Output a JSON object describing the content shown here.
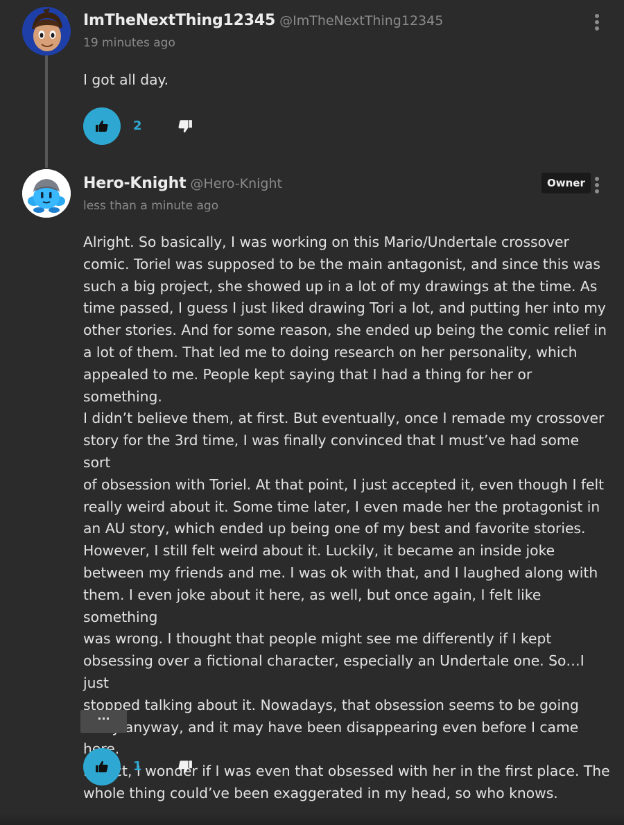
{
  "comments": [
    {
      "username": "ImTheNextThing12345",
      "handle": "@ImTheNextThing12345",
      "timestamp": "19 minutes ago",
      "body": "I got all day.",
      "likes": "2",
      "avatar_icon": "cartoon-character-avatar"
    },
    {
      "username": "Hero-Knight",
      "handle": "@Hero-Knight",
      "timestamp": "less than a minute ago",
      "badge": "Owner",
      "body": "Alright. So basically, I was working on this Mario/Undertale crossover\ncomic. Toriel was supposed to be the main antagonist, and since this was\nsuch a big project, she showed up in a lot of my drawings at the time. As\ntime passed, I guess I just liked drawing Tori a lot, and putting her into my\nother stories. And for some reason, she ended up being the comic relief in\na lot of them. That led me to doing research on her personality, which\nappealed to me. People kept saying that I had a thing for her or something.\nI didn’t believe them, at first. But eventually, once I remade my crossover\nstory for the 3rd time, I was finally convinced that I must’ve had some sort\nof obsession with Toriel. At that point, I just accepted it, even though I felt\nreally weird about it. Some time later, I even made her the protagonist in\nan AU story, which ended up being one of my best and favorite stories.\nHowever, I still felt weird about it. Luckily, it became an inside joke\nbetween my friends and me. I was ok with that, and I laughed along with\nthem. I even joke about it here, as well, but once again, I felt like something\nwas wrong. I thought that people might see me differently if I kept\nobsessing over a fictional character, especially an Undertale one. So…I just\nstopped talking about it. Nowadays, that obsession seems to be going\naway anyway, and it may have been disappearing even before I came here.\nIn fact, I wonder if I was even that obsessed with her in the first place. The\nwhole thing could’ve been exaggerated in my head, so who knows.",
      "expand_label": "···",
      "likes": "1",
      "avatar_icon": "blue-kirby-avatar"
    }
  ],
  "icons": {
    "like": "thumbs-up-icon",
    "dislike": "thumbs-down-icon",
    "more": "vertical-ellipsis-icon"
  },
  "colors": {
    "background": "#2b2b2b",
    "accent": "#2ea8d2",
    "muted_text": "#8a8a8a",
    "badge_bg": "#1a1a1a"
  }
}
